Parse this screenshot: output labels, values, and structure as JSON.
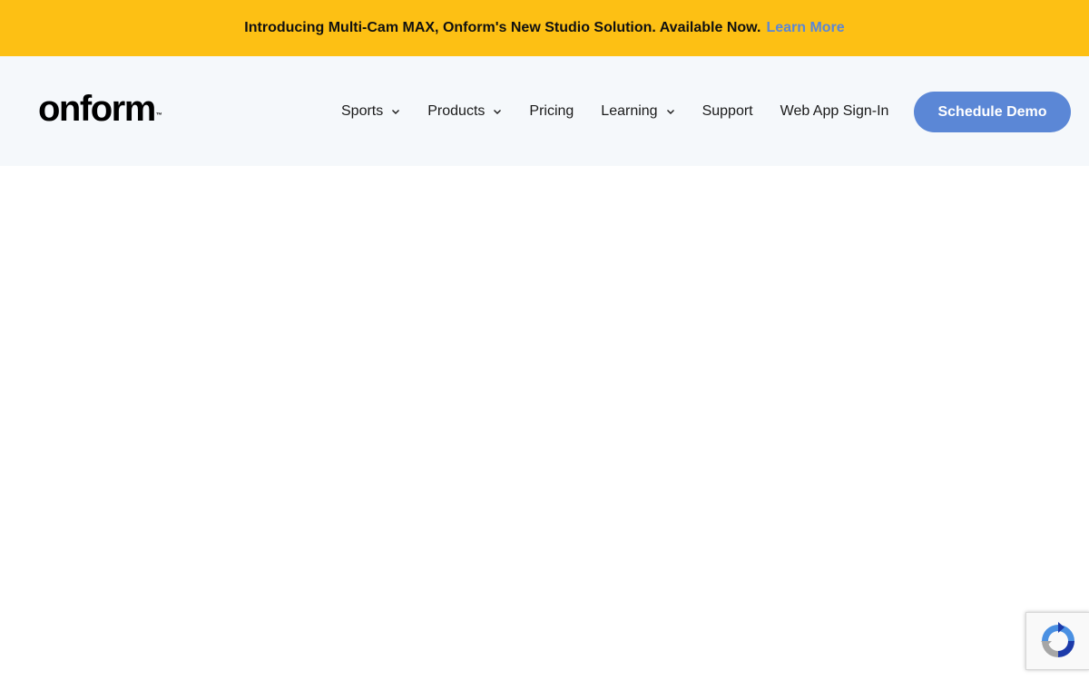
{
  "announcement": {
    "text": "Introducing Multi-Cam MAX, Onform's New Studio Solution. Available Now.",
    "link_label": "Learn More"
  },
  "header": {
    "logo_text": "onform",
    "logo_mark": "™",
    "nav": {
      "sports": "Sports",
      "products": "Products",
      "pricing": "Pricing",
      "learning": "Learning",
      "support": "Support",
      "signin": "Web App Sign-In"
    },
    "cta_label": "Schedule Demo"
  },
  "colors": {
    "announcement_bg": "#fdc014",
    "accent_blue": "#5b87d6",
    "header_bg": "#f5f8fb"
  },
  "icons": {
    "dropdown": "chevron-down-icon",
    "recaptcha": "recaptcha-icon"
  }
}
